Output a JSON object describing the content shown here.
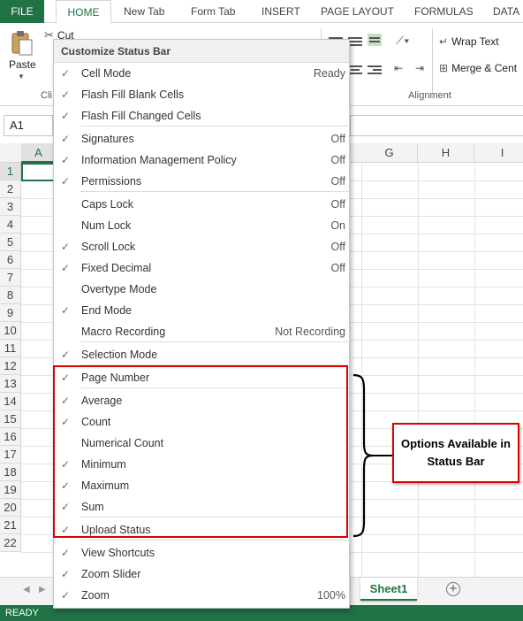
{
  "ribbon_tabs": [
    "FILE",
    "HOME",
    "New Tab",
    "Form Tab",
    "INSERT",
    "PAGE LAYOUT",
    "FORMULAS",
    "DATA"
  ],
  "ribbon": {
    "paste_label": "Paste",
    "cut_label": "Cut",
    "clipboard_label": "Cli",
    "wrap_text_label": "Wrap Text",
    "merge_label": "Merge & Cent",
    "alignment_label": "Alignment"
  },
  "formula_bar": {
    "name_box": "A1"
  },
  "grid": {
    "columns": [
      {
        "label": "A",
        "selected": true
      },
      {
        "label": "G",
        "selected": false
      },
      {
        "label": "H",
        "selected": false
      },
      {
        "label": "I",
        "selected": false
      }
    ],
    "rows": [
      "1",
      "2",
      "3",
      "4",
      "5",
      "6",
      "7",
      "8",
      "9",
      "10",
      "11",
      "12",
      "13",
      "14",
      "15",
      "16",
      "17",
      "18",
      "19",
      "20",
      "21",
      "22"
    ]
  },
  "sheet_tabs": {
    "active": "Sheet1",
    "add_symbol": "+"
  },
  "status_bar": {
    "text": "READY"
  },
  "menu": {
    "title": "Customize Status Bar",
    "items": [
      {
        "label": "Cell Mode",
        "checked": true,
        "value": "Ready"
      },
      {
        "label": "Flash Fill Blank Cells",
        "checked": true,
        "value": ""
      },
      {
        "label": "Flash Fill Changed Cells",
        "checked": true,
        "value": ""
      },
      {
        "label": "Signatures",
        "checked": true,
        "value": "Off"
      },
      {
        "label": "Information Management Policy",
        "checked": true,
        "value": "Off"
      },
      {
        "label": "Permissions",
        "checked": true,
        "value": "Off"
      },
      {
        "label": "Caps Lock",
        "checked": false,
        "value": "Off"
      },
      {
        "label": "Num Lock",
        "checked": false,
        "value": "On"
      },
      {
        "label": "Scroll Lock",
        "checked": true,
        "value": "Off"
      },
      {
        "label": "Fixed Decimal",
        "checked": true,
        "value": "Off"
      },
      {
        "label": "Overtype Mode",
        "checked": false,
        "value": ""
      },
      {
        "label": "End Mode",
        "checked": true,
        "value": ""
      },
      {
        "label": "Macro Recording",
        "checked": false,
        "value": "Not Recording"
      },
      {
        "label": "Selection Mode",
        "checked": true,
        "value": ""
      },
      {
        "label": "Page Number",
        "checked": true,
        "value": ""
      },
      {
        "label": "Average",
        "checked": true,
        "value": ""
      },
      {
        "label": "Count",
        "checked": true,
        "value": ""
      },
      {
        "label": "Numerical Count",
        "checked": false,
        "value": ""
      },
      {
        "label": "Minimum",
        "checked": true,
        "value": ""
      },
      {
        "label": "Maximum",
        "checked": true,
        "value": ""
      },
      {
        "label": "Sum",
        "checked": true,
        "value": ""
      },
      {
        "label": "Upload Status",
        "checked": true,
        "value": ""
      },
      {
        "label": "View Shortcuts",
        "checked": true,
        "value": ""
      },
      {
        "label": "Zoom Slider",
        "checked": true,
        "value": ""
      },
      {
        "label": "Zoom",
        "checked": true,
        "value": "100%"
      }
    ]
  },
  "annotation": {
    "callout_text": "Options Available in Status Bar"
  },
  "colors": {
    "excel_green": "#217346",
    "annotation_red": "#d90000"
  }
}
